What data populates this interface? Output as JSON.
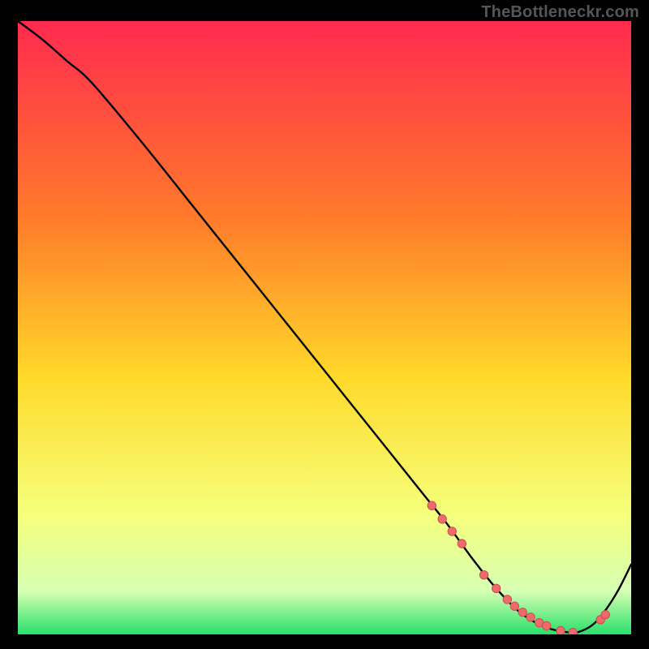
{
  "watermark": "TheBottleneckr.com",
  "colors": {
    "gradient_top": "#ff2a4f",
    "gradient_upper_mid": "#ff7a2a",
    "gradient_mid": "#ffd92a",
    "gradient_lower_mid": "#f6ff7a",
    "gradient_near_bottom": "#d6ffb3",
    "gradient_bottom": "#27e06a",
    "curve": "#000000",
    "marker_fill": "#ef6a6a",
    "marker_stroke": "#c94f4f",
    "frame": "#000000"
  },
  "chart_data": {
    "type": "line",
    "title": "",
    "xlabel": "",
    "ylabel": "",
    "xlim": [
      0,
      100
    ],
    "ylim": [
      0,
      100
    ],
    "grid": false,
    "legend": false,
    "series": [
      {
        "name": "bottleneck-curve",
        "x": [
          0,
          4,
          8,
          12,
          20,
          30,
          40,
          50,
          60,
          66,
          70,
          74,
          78,
          82,
          86,
          90,
          92,
          94,
          96,
          98,
          100
        ],
        "y": [
          100,
          97,
          93.5,
          90,
          80.5,
          68,
          55.5,
          43,
          30.5,
          23,
          18,
          12.5,
          7.5,
          3.5,
          1.2,
          0.3,
          0.6,
          1.8,
          4.2,
          7.4,
          11.4
        ]
      }
    ],
    "markers": {
      "name": "highlight-points",
      "x": [
        67.5,
        69.2,
        70.8,
        72.4,
        76.0,
        78.0,
        79.8,
        81.0,
        82.3,
        83.6,
        85.0,
        86.2,
        88.5,
        90.5,
        95.0,
        95.8
      ],
      "y": [
        21.0,
        18.8,
        16.8,
        14.8,
        9.7,
        7.5,
        5.7,
        4.6,
        3.6,
        2.8,
        1.9,
        1.4,
        0.6,
        0.3,
        2.4,
        3.2
      ]
    }
  }
}
